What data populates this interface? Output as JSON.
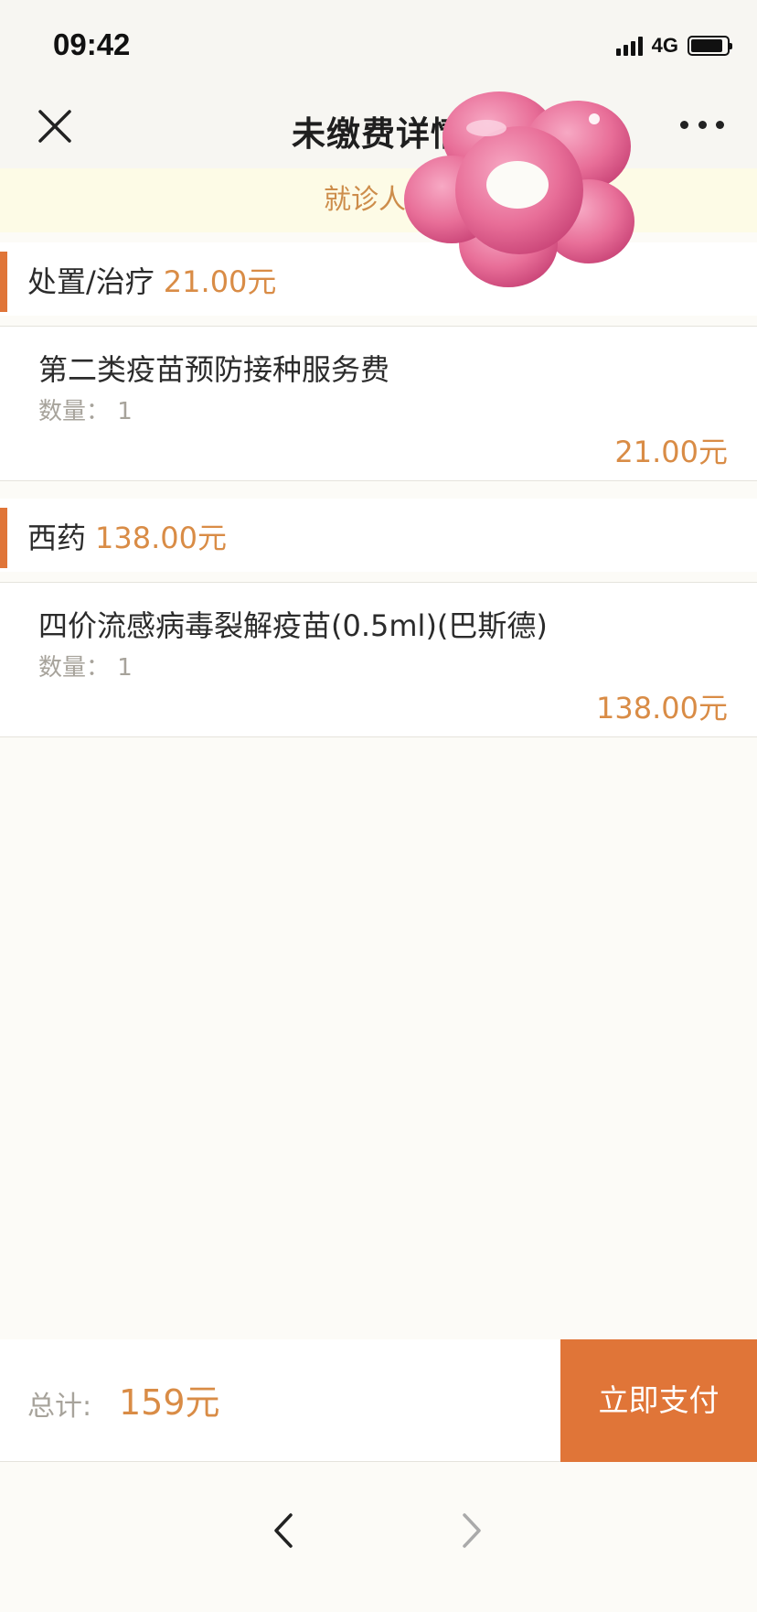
{
  "status_bar": {
    "time": "09:42",
    "network": "4G"
  },
  "nav": {
    "title": "未缴费详情",
    "close_icon": "close-icon",
    "more_icon": "more-icon"
  },
  "patient": {
    "label": "就诊人："
  },
  "sections": [
    {
      "category": "处置/治疗",
      "amount": "21.00元",
      "items": [
        {
          "name": "第二类疫苗预防接种服务费",
          "quantity": "数量： 1",
          "price": "21.00元"
        }
      ]
    },
    {
      "category": "西药",
      "amount": "138.00元",
      "items": [
        {
          "name": "四价流感病毒裂解疫苗(0.5ml)(巴斯德)",
          "quantity": "数量： 1",
          "price": "138.00元"
        }
      ]
    }
  ],
  "footer": {
    "total_label": "总计:",
    "total_value": "159元",
    "pay_label": "立即支付"
  },
  "browser": {
    "back_icon": "chevron-left-icon",
    "forward_icon": "chevron-right-icon"
  },
  "colors": {
    "accent": "#e07538",
    "price": "#d98c46",
    "notice_bg": "#fdfbe6"
  }
}
